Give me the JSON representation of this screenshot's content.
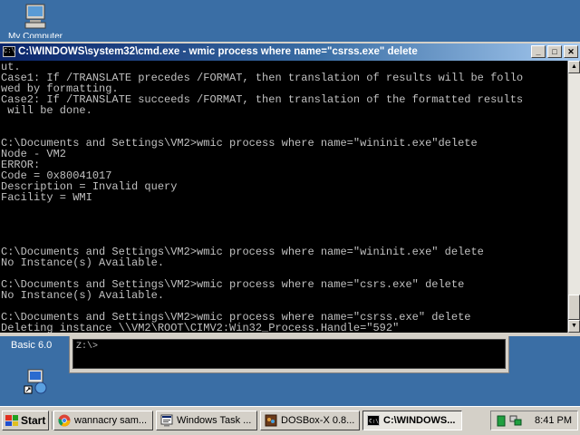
{
  "desktop": {
    "icons": [
      {
        "name": "my-computer",
        "label": "My Computer"
      },
      {
        "name": "basic",
        "label": "Basic 6.0"
      }
    ]
  },
  "dosbox_window": {
    "prompt": "Z:\\>"
  },
  "cmd_window": {
    "title": "C:\\WINDOWS\\system32\\cmd.exe - wmic process where name=\"csrss.exe\" delete",
    "lines": [
      "ut.",
      "Case1: If /TRANSLATE precedes /FORMAT, then translation of results will be follo",
      "wed by formatting.",
      "Case2: If /TRANSLATE succeeds /FORMAT, then translation of the formatted results",
      " will be done.",
      "",
      "",
      "C:\\Documents and Settings\\VM2>wmic process where name=\"wininit.exe\"delete",
      "Node - VM2",
      "ERROR:",
      "Code = 0x80041017",
      "Description = Invalid query",
      "Facility = WMI",
      "",
      "",
      "",
      "",
      "C:\\Documents and Settings\\VM2>wmic process where name=\"wininit.exe\" delete",
      "No Instance(s) Available.",
      "",
      "C:\\Documents and Settings\\VM2>wmic process where name=\"csrs.exe\" delete",
      "No Instance(s) Available.",
      "",
      "C:\\Documents and Settings\\VM2>wmic process where name=\"csrss.exe\" delete",
      "Deleting instance \\\\VM2\\ROOT\\CIMV2:Win32_Process.Handle=\"592\""
    ]
  },
  "taskbar": {
    "start_label": "Start",
    "tasks": [
      {
        "label": "wannacry sam...",
        "icon": "chrome-icon",
        "active": false
      },
      {
        "label": "Windows Task ...",
        "icon": "task-manager-icon",
        "active": false
      },
      {
        "label": "DOSBox-X 0.8...",
        "icon": "dosbox-icon",
        "active": false
      },
      {
        "label": "C:\\WINDOWS...",
        "icon": "cmd-icon",
        "active": true
      }
    ],
    "clock": "8:41 PM"
  },
  "colors": {
    "desktop": "#3a6ea5",
    "title_active_start": "#0a246a",
    "console_text": "#c0c0c0"
  }
}
